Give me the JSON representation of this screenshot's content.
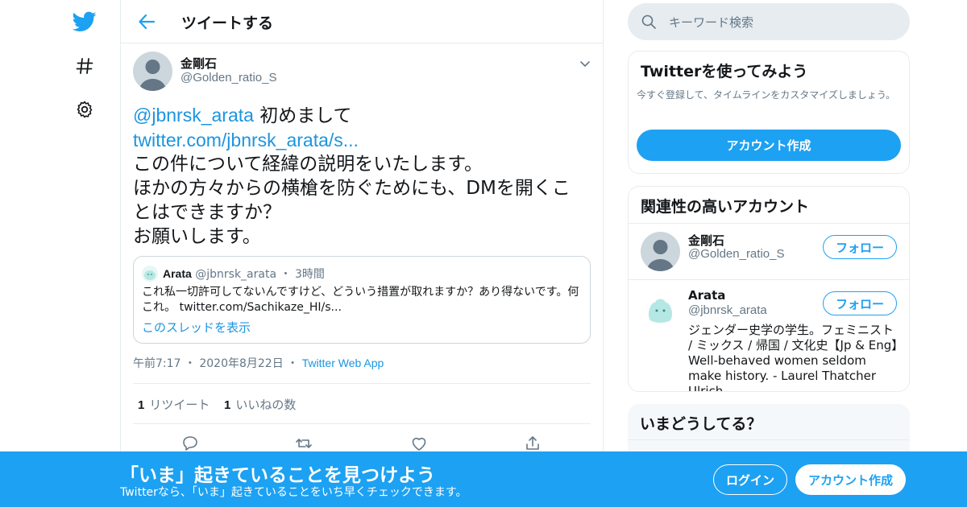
{
  "colors": {
    "accent": "#1da1f2",
    "link": "#1b95e0",
    "secondary_text": "#657786",
    "border": "#e6ecf0"
  },
  "nav": {
    "items": [
      {
        "icon": "twitter-logo-icon"
      },
      {
        "icon": "hashtag-icon"
      },
      {
        "icon": "gear-icon"
      }
    ]
  },
  "header": {
    "title": "ツイートする"
  },
  "tweet": {
    "author_name": "金剛石",
    "author_handle": "@Golden_ratio_S",
    "mention": "@jbnrsk_arata",
    "text_line1": " 初めまして",
    "link": "twitter.com/jbnrsk_arata/s...",
    "text_line2": "この件について経緯の説明をいたします。",
    "text_line3": "ほかの方々からの横槍を防ぐためにも、DMを開くことはできますか？",
    "text_line4": "お願いします。",
    "time": "午前7:17",
    "date": "2020年8月22日",
    "source": "Twitter Web App",
    "retweet_count": "1",
    "retweet_label": "リツイート",
    "like_count": "1",
    "like_label": "いいねの数"
  },
  "quote": {
    "name": "Arata",
    "handle": "@jbnrsk_arata",
    "age": "3時間",
    "text": "これ私一切許可してないんですけど、どういう措置が取れますか？あり得ないです。何これ。 twitter.com/Sachikaze_HI/s...",
    "thread_link": "このスレッドを表示"
  },
  "search": {
    "placeholder": "キーワード検索"
  },
  "signup_card": {
    "title": "Twitterを使ってみよう",
    "description": "今すぐ登録して、タイムラインをカスタマイズしましょう。",
    "button": "アカウント作成"
  },
  "related": {
    "title": "関連性の高いアカウント",
    "accounts": [
      {
        "name": "金剛石",
        "handle": "@Golden_ratio_S",
        "follow": "フォロー"
      },
      {
        "name": "Arata",
        "handle": "@jbnrsk_arata",
        "follow": "フォロー",
        "bio": "ジェンダー史学の学生。フェミニスト / ミックス / 帰国 / 文化史【Jp & Eng】Well-behaved women seldom make history. - Laurel Thatcher Ulrich"
      }
    ]
  },
  "trends": {
    "title": "いまどうしてる？"
  },
  "bottom_bar": {
    "title": "「いま」起きていることを見つけよう",
    "subtitle": "Twitterなら、「いま」起きていることをいち早くチェックできます。",
    "login": "ログイン",
    "signup": "アカウント作成"
  }
}
